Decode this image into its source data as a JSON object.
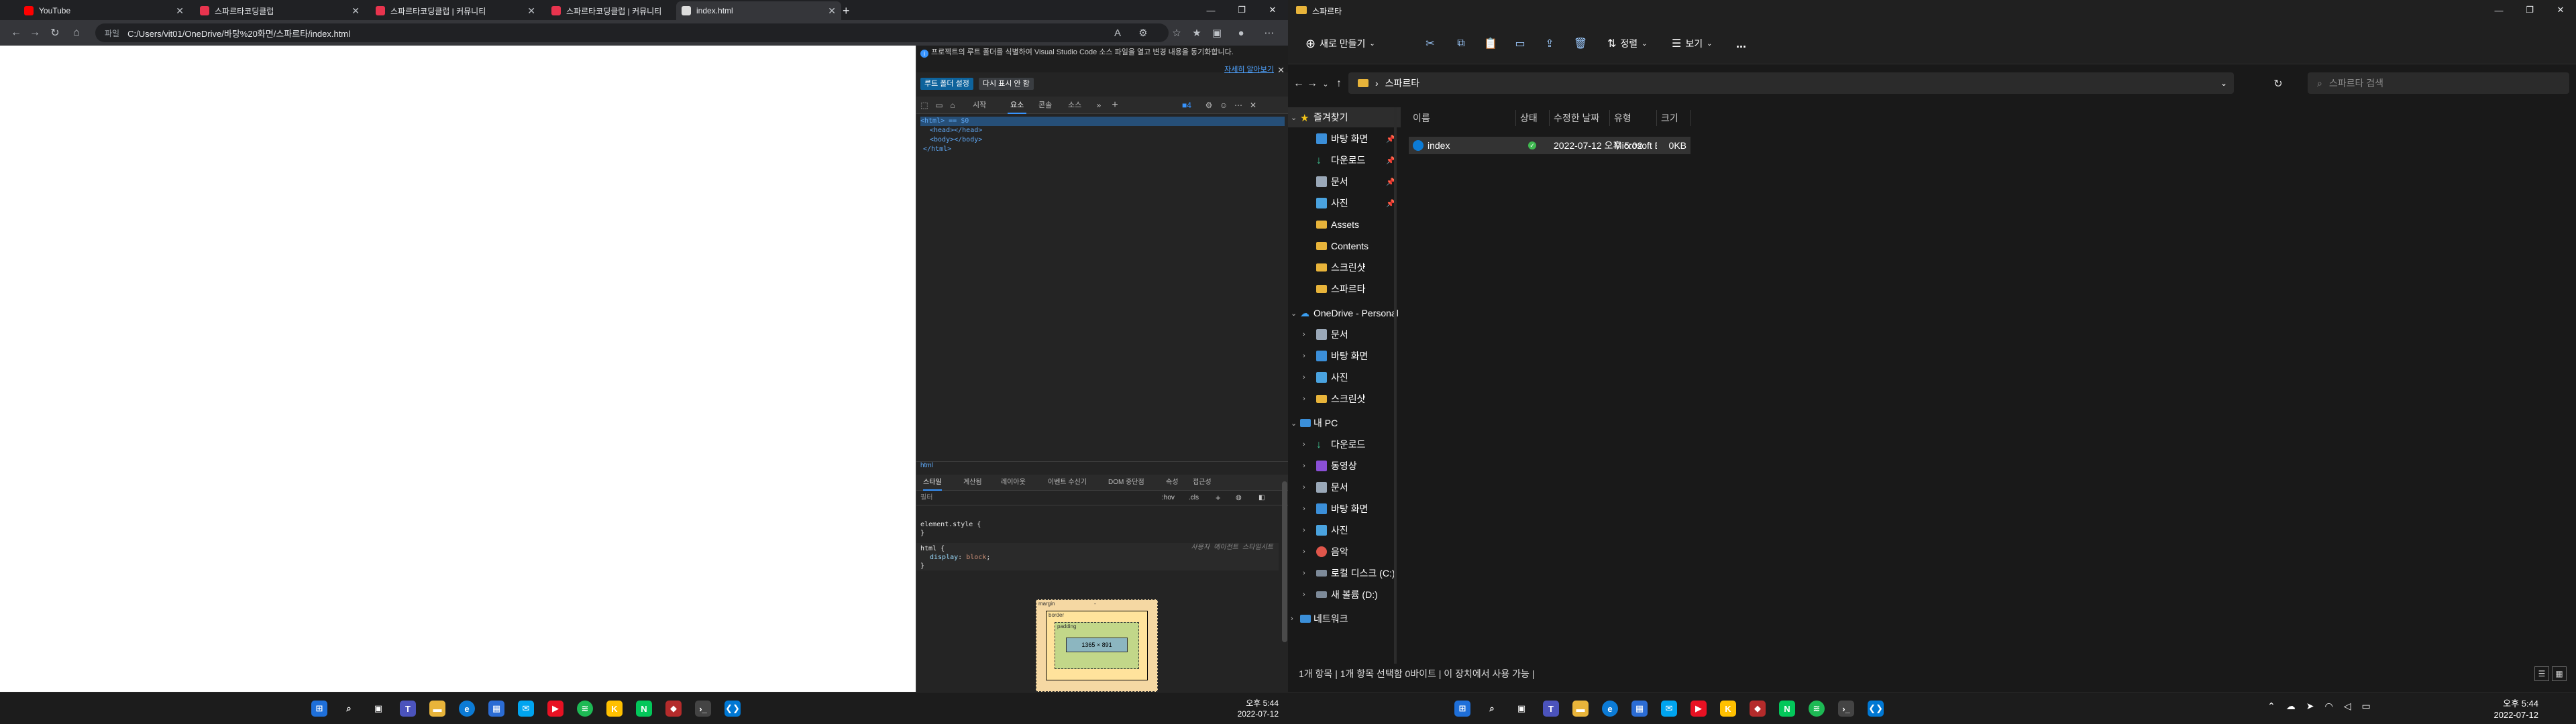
{
  "browser": {
    "tabs": [
      {
        "title": "YouTube",
        "favicon_color": "#ff0000",
        "active": false
      },
      {
        "title": "스파르타코딩클럽",
        "favicon_color": "#e8344e",
        "active": false
      },
      {
        "title": "스파르타코딩클럽 | 커뮤니티",
        "favicon_color": "#e8344e",
        "active": false
      },
      {
        "title": "스파르타코딩클럽 | 커뮤니티",
        "favicon_color": "#e8344e",
        "active": false
      },
      {
        "title": "index.html",
        "favicon_color": "#dddddd",
        "active": true
      }
    ],
    "new_tab_icon": "+",
    "address": {
      "info_label": "파일",
      "url": "C:/Users/vit01/OneDrive/바탕%20화면/스파르타/index.html"
    }
  },
  "devtools": {
    "banner_text": "프로젝트의 루트 폴더를 식별하여 Visual Studio Code 소스 파일을 열고 변경 내용을 동기화합니다.",
    "banner_more": "자세히 알아보기",
    "banner_button_primary": "루트 폴더 설정",
    "banner_button_secondary": "다시 표시 안 함",
    "tabs": [
      "시작",
      "요소",
      "콘솔",
      "소스"
    ],
    "active_tab": "요소",
    "issues_count": "4",
    "dom_lines": [
      "<html> == $0",
      "<head></head>",
      "<body></body>",
      "</html>"
    ],
    "breadcrumb": "html",
    "style_tabs": [
      "스타일",
      "계산됨",
      "레이아웃",
      "이벤트 수신기",
      "DOM 중단점",
      "속성",
      "접근성"
    ],
    "filter_placeholder": "필터",
    "filter_hov": ":hov",
    "filter_cls": ".cls",
    "rules": [
      {
        "selector": "element.style {",
        "close": "}",
        "source": "",
        "props": []
      },
      {
        "selector": "html {",
        "close": "}",
        "source": "사용자 에이전트 스타일시트",
        "props": [
          {
            "name": "display",
            "value": "block"
          }
        ]
      }
    ],
    "boxmodel": {
      "margin_label": "margin",
      "border_label": "border",
      "padding_label": "padding",
      "content_size": "1365 × 891",
      "dash": "-"
    }
  },
  "explorer": {
    "window_title": "스파르타",
    "commands": {
      "new": "새로 만들기",
      "sort": "정렬",
      "view": "보기",
      "more": "..."
    },
    "path": "스파르타",
    "search_placeholder": "스파르타 검색",
    "nav": {
      "quick_access": "즐겨찾기",
      "quick_items": [
        "바탕 화면",
        "다운로드",
        "문서",
        "사진",
        "Assets",
        "Contents",
        "스크린샷",
        "스파르타"
      ],
      "onedrive": "OneDrive - Personal",
      "onedrive_items": [
        "문서",
        "바탕 화면",
        "사진",
        "스크린샷"
      ],
      "thispc": "내 PC",
      "pc_items": [
        "다운로드",
        "동영상",
        "문서",
        "바탕 화면",
        "사진",
        "음악",
        "로컬 디스크 (C:)",
        "새 볼륨 (D:)"
      ],
      "network": "네트워크"
    },
    "columns": [
      "이름",
      "상태",
      "수정한 날짜",
      "유형",
      "크기"
    ],
    "files": [
      {
        "name": "index",
        "date": "2022-07-12 오후 5:02",
        "type": "Microsoft Edge H...",
        "size": "0KB"
      }
    ],
    "status": "1개 항목  |  1개 항목 선택함 0바이트  |  이 장치에서 사용 가능  |"
  },
  "taskbar_left": {
    "time": "오후 5:44",
    "date": "2022-07-12"
  },
  "taskbar_right": {
    "time": "오후 5:44",
    "date": "2022-07-12"
  }
}
